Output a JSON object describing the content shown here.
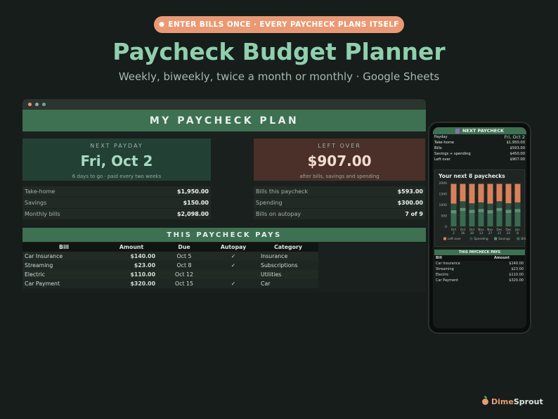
{
  "banner": {
    "text": "ENTER BILLS ONCE · EVERY PAYCHECK PLANS ITSELF"
  },
  "title": "Paycheck Budget Planner",
  "subtitle": "Weekly, biweekly, twice a month or monthly · Google Sheets",
  "colors": {
    "accent_green": "#3e7052",
    "accent_orange": "#e99a75",
    "title_green": "#8fcfae",
    "background": "#161d1a"
  },
  "sheet": {
    "header": "MY PAYCHECK PLAN",
    "next_payday": {
      "label": "NEXT PAYDAY",
      "value": "Fri, Oct 2",
      "note": "6 days to go · paid every two weeks"
    },
    "left_over": {
      "label": "LEFT OVER",
      "value": "$907.00",
      "note": "after bills, savings and spending"
    },
    "left_stats": [
      {
        "k": "Take-home",
        "v": "$1,950.00"
      },
      {
        "k": "Savings",
        "v": "$150.00"
      },
      {
        "k": "Monthly bills",
        "v": "$2,098.00"
      }
    ],
    "right_stats": [
      {
        "k": "Bills this paycheck",
        "v": "$593.00"
      },
      {
        "k": "Spending",
        "v": "$300.00"
      },
      {
        "k": "Bills on autopay",
        "v": "7 of 9"
      }
    ],
    "pays_header": "THIS PAYCHECK PAYS",
    "columns": [
      "Bill",
      "Amount",
      "Due",
      "Autopay",
      "Category"
    ],
    "bills": [
      {
        "bill": "Car Insurance",
        "amount": "$140.00",
        "due": "Oct 5",
        "autopay": "✓",
        "category": "Insurance"
      },
      {
        "bill": "Streaming",
        "amount": "$23.00",
        "due": "Oct 8",
        "autopay": "✓",
        "category": "Subscriptions"
      },
      {
        "bill": "Electric",
        "amount": "$110.00",
        "due": "Oct 12",
        "autopay": "",
        "category": "Utilities"
      },
      {
        "bill": "Car Payment",
        "amount": "$320.00",
        "due": "Oct 15",
        "autopay": "✓",
        "category": "Car"
      }
    ]
  },
  "phone": {
    "header": "NEXT PAYCHECK",
    "rows": [
      {
        "k": "Payday",
        "v": "Fri, Oct 2"
      },
      {
        "k": "Take-home",
        "v": "$1,950.00"
      },
      {
        "k": "Bills",
        "v": "$593.00"
      },
      {
        "k": "Savings + spending",
        "v": "$450.00"
      },
      {
        "k": "Left over",
        "v": "$907.00"
      }
    ],
    "chart_title": "Your next 8 paychecks",
    "pays_header": "THIS PAYCHECK PAYS",
    "bill_columns": [
      "Bill",
      "Amount"
    ],
    "bills": [
      {
        "bill": "Car Insurance",
        "amount": "$140.00"
      },
      {
        "bill": "Streaming",
        "amount": "$23.00"
      },
      {
        "bill": "Electric",
        "amount": "$110.00"
      },
      {
        "bill": "Car Payment",
        "amount": "$320.00"
      }
    ]
  },
  "chart_data": {
    "type": "bar",
    "stacked": true,
    "title": "Your next 8 paychecks",
    "categories": [
      "Oct 2",
      "Oct 16",
      "Oct 30",
      "Nov 13",
      "Nov 27",
      "Dec 11",
      "Dec 25",
      "Jan 8"
    ],
    "series": [
      {
        "name": "Bills",
        "color": "#3a6a52",
        "values": [
          593,
          700,
          610,
          650,
          593,
          700,
          610,
          650
        ]
      },
      {
        "name": "Savings",
        "color": "#5e8f78",
        "values": [
          150,
          150,
          150,
          150,
          150,
          150,
          150,
          150
        ]
      },
      {
        "name": "Spending",
        "color": "#2e4d3e",
        "values": [
          300,
          300,
          300,
          300,
          300,
          300,
          300,
          300
        ]
      },
      {
        "name": "Left over",
        "color": "#d9805a",
        "values": [
          907,
          800,
          890,
          850,
          907,
          800,
          890,
          850
        ]
      }
    ],
    "legend_order": [
      "Left over",
      "Spending",
      "Savings",
      "Bills"
    ],
    "yticks": [
      0,
      500,
      1000,
      1500,
      2000
    ],
    "ylim": [
      0,
      2000
    ],
    "legend": "bottom"
  },
  "brand": {
    "part1": "Dime",
    "part2": "Sprout"
  }
}
